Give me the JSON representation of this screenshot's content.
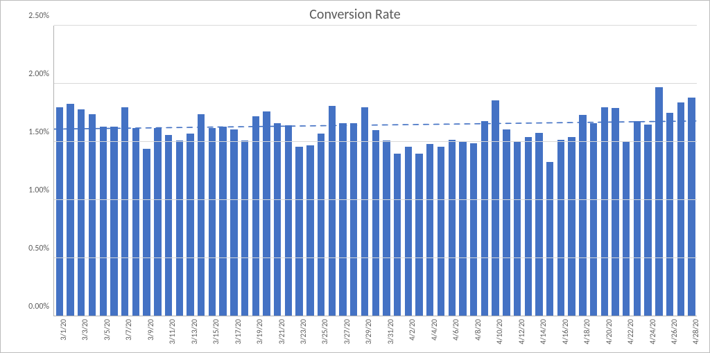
{
  "chart_data": {
    "type": "bar",
    "title": "Conversion Rate",
    "xlabel": "",
    "ylabel": "",
    "ylim": [
      0,
      0.025
    ],
    "y_ticks": [
      "0.00%",
      "0.50%",
      "1.00%",
      "1.50%",
      "2.00%",
      "2.50%"
    ],
    "x_tick_interval": 2,
    "categories": [
      "3/1/20",
      "3/2/20",
      "3/3/20",
      "3/4/20",
      "3/5/20",
      "3/6/20",
      "3/7/20",
      "3/8/20",
      "3/9/20",
      "3/10/20",
      "3/11/20",
      "3/12/20",
      "3/13/20",
      "3/14/20",
      "3/15/20",
      "3/16/20",
      "3/17/20",
      "3/18/20",
      "3/19/20",
      "3/20/20",
      "3/21/20",
      "3/22/20",
      "3/23/20",
      "3/24/20",
      "3/25/20",
      "3/26/20",
      "3/27/20",
      "3/28/20",
      "3/29/20",
      "3/30/20",
      "3/31/20",
      "4/1/20",
      "4/2/20",
      "4/3/20",
      "4/4/20",
      "4/5/20",
      "4/6/20",
      "4/7/20",
      "4/8/20",
      "4/9/20",
      "4/10/20",
      "4/11/20",
      "4/12/20",
      "4/13/20",
      "4/14/20",
      "4/15/20",
      "4/16/20",
      "4/17/20",
      "4/18/20",
      "4/19/20",
      "4/20/20",
      "4/21/20",
      "4/22/20",
      "4/23/20",
      "4/24/20",
      "4/25/20",
      "4/26/20",
      "4/27/20",
      "4/28/20"
    ],
    "values_percent": [
      1.8,
      1.83,
      1.78,
      1.74,
      1.63,
      1.63,
      1.8,
      1.62,
      1.44,
      1.62,
      1.56,
      1.51,
      1.57,
      1.74,
      1.62,
      1.63,
      1.61,
      1.51,
      1.72,
      1.76,
      1.66,
      1.64,
      1.46,
      1.47,
      1.57,
      1.81,
      1.66,
      1.66,
      1.8,
      1.6,
      1.51,
      1.4,
      1.46,
      1.4,
      1.48,
      1.46,
      1.52,
      1.5,
      1.49,
      1.68,
      1.86,
      1.61,
      1.5,
      1.54,
      1.58,
      1.33,
      1.52,
      1.54,
      1.73,
      1.66,
      1.8,
      1.79,
      1.5,
      1.68,
      1.65,
      1.97,
      1.75,
      1.84,
      1.88
    ],
    "trendline_percent": {
      "start": 1.61,
      "end": 1.68
    },
    "colors": {
      "bar": "#4472C4",
      "trend": "#4472C4",
      "grid": "#d9d9d9",
      "axis": "#b0b0b0"
    }
  }
}
